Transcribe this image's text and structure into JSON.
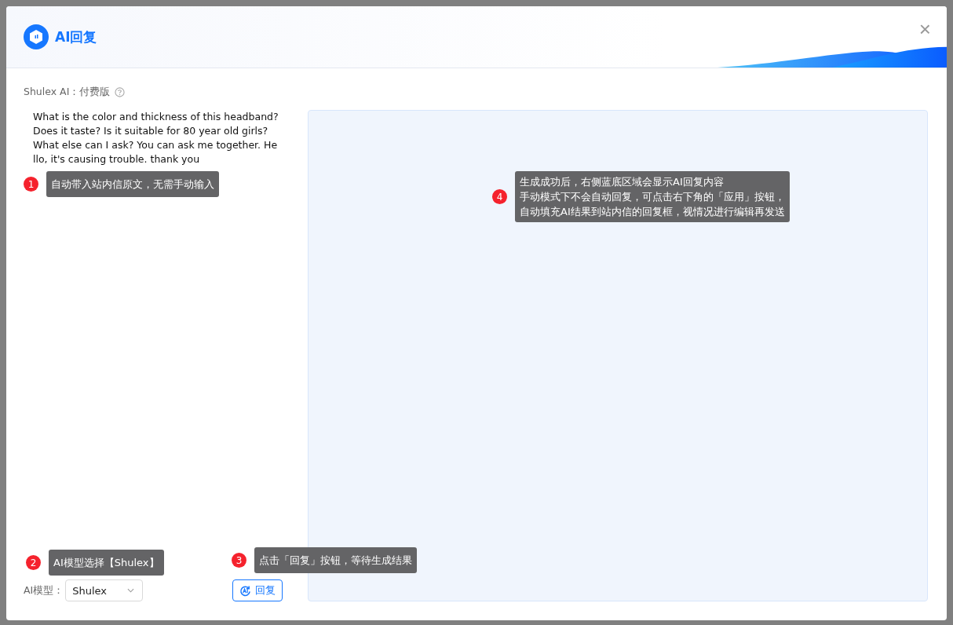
{
  "dialog": {
    "title": "AI回复",
    "close": "×"
  },
  "plan": {
    "label": "Shulex AI：付费版"
  },
  "message": "What is the color and thickness of this headband? Does it taste? Is it suitable for 80 year old girls? What else can I ask? You can ask me together. Hello, it's causing trouble. thank you",
  "model": {
    "label": "AI模型：",
    "value": "Shulex"
  },
  "reply_button": "回复",
  "hints": [
    {
      "number": "1",
      "lines": [
        "自动带入站内信原文，无需手动输入"
      ]
    },
    {
      "number": "2",
      "lines": [
        "AI模型选择【Shulex】"
      ]
    },
    {
      "number": "3",
      "lines": [
        "点击「回复」按钮，等待生成结果"
      ]
    },
    {
      "number": "4",
      "lines": [
        "生成成功后，右侧蓝底区域会显示AI回复内容",
        "手动模式下不会自动回复，可点击右下角的「应用」按钮，",
        "自动填充AI结果到站内信的回复框，视情况进行编辑再发送"
      ]
    }
  ]
}
